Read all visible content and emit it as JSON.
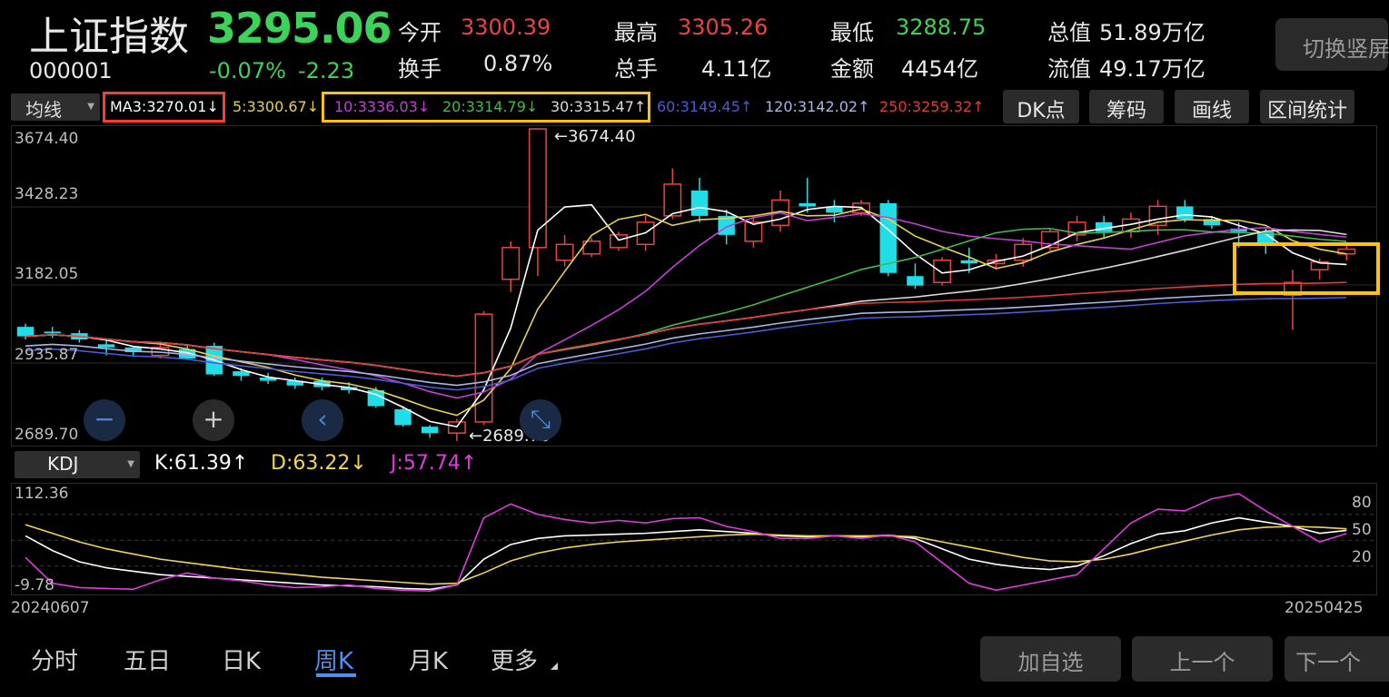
{
  "header": {
    "name": "上证指数",
    "code": "000001",
    "price": "3295.06",
    "change_pct": "-0.07%",
    "change": "-2.23",
    "open_label": "今开",
    "open": "3300.39",
    "high_label": "最高",
    "high": "3305.26",
    "low_label": "最低",
    "low": "3288.75",
    "total_value_label": "总值",
    "total_value": "51.89万亿",
    "turnover_label": "换手",
    "turnover": "0.87%",
    "volume_label": "总手",
    "volume": "4.11亿",
    "amount_label": "金额",
    "amount": "4454亿",
    "float_value_label": "流值",
    "float_value": "49.17万亿",
    "switch_label": "切换竖屏"
  },
  "ma_bar": {
    "selector": "均线",
    "ma3": "MA3:3270.01↓",
    "ma5": "5:3300.67↓",
    "ma10": "10:3336.03↓",
    "ma20": "20:3314.79↓",
    "ma30": "30:3315.47↑",
    "ma60": "60:3149.45↑",
    "ma120": "120:3142.02↑",
    "ma250": "250:3259.32↑",
    "btn_dk": "DK点",
    "btn_chips": "筹码",
    "btn_draw": "画线",
    "btn_stats": "区间统计"
  },
  "axes": {
    "y1": "3674.40",
    "y2": "3428.23",
    "y3": "3182.05",
    "y4": "2935.87",
    "y5": "2689.70",
    "high_label": "←3674.40",
    "low_label": "←2689.70",
    "kdj_top": "112.36",
    "kdj_bottom": "-9.78",
    "kdj_80": "80",
    "kdj_50": "50",
    "kdj_20": "20",
    "date_start": "20240607",
    "date_end": "20250425"
  },
  "kdj": {
    "selector": "KDJ",
    "k": "K:61.39↑",
    "d": "D:63.22↓",
    "j": "J:57.74↑"
  },
  "nav": {
    "tab1": "分时",
    "tab2": "五日",
    "tab3": "日K",
    "tab4": "周K",
    "tab5": "月K",
    "tab6": "更多"
  },
  "bottom": {
    "add": "加自选",
    "prev": "上一个",
    "next": "下一个"
  },
  "controls": {
    "zoom_out": "−",
    "zoom_in": "+",
    "back": "‹",
    "shrink": "⤡"
  },
  "colors": {
    "up": "#e94444",
    "down": "#21dde8",
    "price_down": "#3cd35a",
    "active_tab": "#4e8ff0",
    "highlight": "#ffc400",
    "alert": "#ff3b30"
  },
  "chart_data": {
    "type": "candlestick",
    "period": "weekly",
    "y_range": [
      2689.7,
      3674.4
    ],
    "candles": [
      [
        3050,
        3020,
        3060,
        3010
      ],
      [
        3035,
        3030,
        3050,
        3015
      ],
      [
        3030,
        3010,
        3040,
        3000
      ],
      [
        2995,
        2985,
        3010,
        2960
      ],
      [
        2985,
        2970,
        2990,
        2955
      ],
      [
        2960,
        2985,
        3000,
        2950
      ],
      [
        2980,
        2950,
        2990,
        2945
      ],
      [
        2990,
        2900,
        3000,
        2895
      ],
      [
        2910,
        2895,
        2920,
        2880
      ],
      [
        2890,
        2880,
        2905,
        2870
      ],
      [
        2880,
        2865,
        2890,
        2855
      ],
      [
        2880,
        2860,
        2890,
        2850
      ],
      [
        2860,
        2850,
        2875,
        2840
      ],
      [
        2850,
        2800,
        2860,
        2795
      ],
      [
        2790,
        2740,
        2800,
        2735
      ],
      [
        2735,
        2715,
        2740,
        2700
      ],
      [
        2715,
        2750,
        2760,
        2689.7
      ],
      [
        2750,
        3090,
        3100,
        2740
      ],
      [
        3200,
        3300,
        3320,
        3160
      ],
      [
        3300,
        3674.4,
        3674.4,
        3210
      ],
      [
        3260,
        3310,
        3340,
        3240
      ],
      [
        3280,
        3320,
        3330,
        3270
      ],
      [
        3300,
        3340,
        3350,
        3290
      ],
      [
        3310,
        3380,
        3400,
        3290
      ],
      [
        3400,
        3500,
        3550,
        3390
      ],
      [
        3480,
        3400,
        3520,
        3380
      ],
      [
        3400,
        3340,
        3420,
        3310
      ],
      [
        3320,
        3380,
        3400,
        3300
      ],
      [
        3370,
        3450,
        3480,
        3350
      ],
      [
        3440,
        3430,
        3520,
        3410
      ],
      [
        3430,
        3410,
        3450,
        3380
      ],
      [
        3410,
        3440,
        3450,
        3400
      ],
      [
        3440,
        3220,
        3450,
        3210
      ],
      [
        3210,
        3180,
        3250,
        3170
      ],
      [
        3190,
        3260,
        3270,
        3180
      ],
      [
        3260,
        3250,
        3300,
        3220
      ],
      [
        3250,
        3260,
        3280,
        3230
      ],
      [
        3260,
        3310,
        3330,
        3240
      ],
      [
        3300,
        3350,
        3360,
        3290
      ],
      [
        3340,
        3380,
        3400,
        3320
      ],
      [
        3380,
        3350,
        3400,
        3330
      ],
      [
        3350,
        3390,
        3410,
        3330
      ],
      [
        3370,
        3430,
        3450,
        3340
      ],
      [
        3430,
        3390,
        3450,
        3380
      ],
      [
        3390,
        3370,
        3400,
        3360
      ],
      [
        3360,
        3350,
        3380,
        3300
      ],
      [
        3350,
        3310,
        3360,
        3280
      ],
      [
        3150,
        3190,
        3230,
        3040
      ],
      [
        3230,
        3255,
        3265,
        3200
      ],
      [
        3280,
        3295,
        3305,
        3260
      ]
    ],
    "kdj_range": [
      -9.78,
      112.36
    ],
    "k": [
      55,
      38,
      25,
      18,
      14,
      10,
      8,
      6,
      4,
      2,
      0,
      -2,
      -3,
      -4,
      -6,
      -7,
      -2,
      28,
      45,
      52,
      55,
      56,
      57,
      58,
      60,
      62,
      60,
      58,
      55,
      54,
      55,
      54,
      56,
      52,
      40,
      28,
      22,
      18,
      16,
      20,
      32,
      46,
      57,
      61,
      70,
      76,
      71,
      66,
      58,
      61.39
    ],
    "d": [
      68,
      58,
      48,
      40,
      34,
      28,
      24,
      20,
      16,
      13,
      10,
      7,
      5,
      3,
      1,
      -1,
      0,
      12,
      26,
      35,
      41,
      45,
      48,
      50,
      52,
      54,
      56,
      57,
      56,
      55,
      55,
      55,
      55,
      54,
      48,
      42,
      36,
      30,
      26,
      25,
      28,
      34,
      42,
      49,
      56,
      62,
      65,
      66,
      65,
      63.22
    ],
    "j": [
      30,
      0,
      -5,
      -6,
      -7,
      4,
      12,
      6,
      3,
      -2,
      -5,
      -4,
      -2,
      -6,
      -8,
      -9,
      -2,
      76,
      92,
      80,
      74,
      70,
      73,
      70,
      75,
      76,
      66,
      60,
      52,
      52,
      55,
      52,
      56,
      48,
      24,
      0,
      -8,
      -2,
      4,
      10,
      40,
      70,
      86,
      84,
      98,
      104,
      84,
      66,
      48,
      57.74
    ]
  }
}
